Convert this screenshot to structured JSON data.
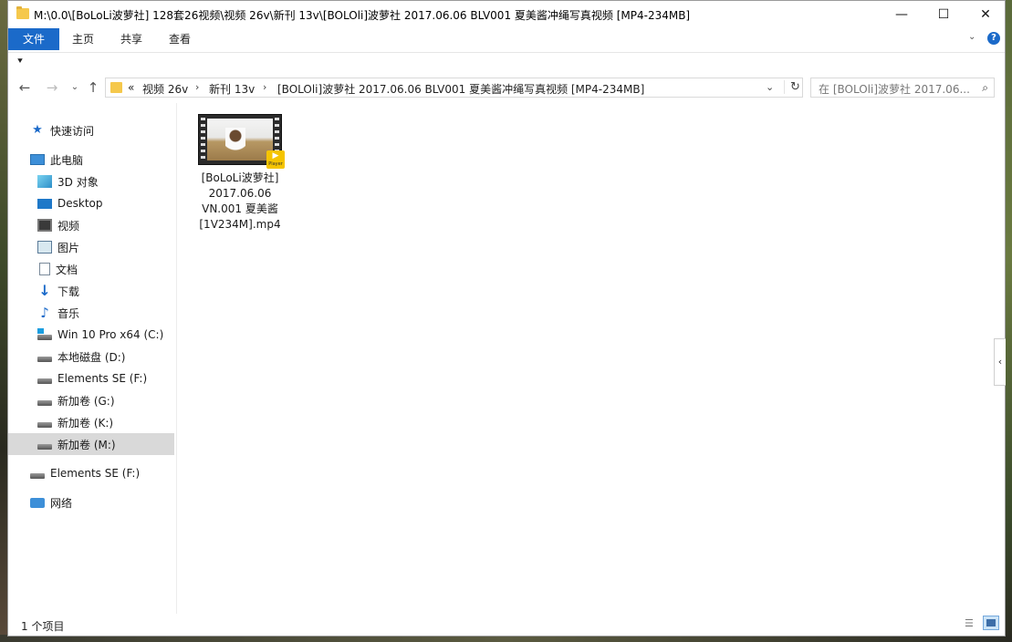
{
  "window": {
    "title": "M:\\0.0\\[BoLoLi波萝社] 128套26视频\\视频 26v\\新刊 13v\\[BOLOli]波萝社 2017.06.06 BLV001 夏美酱冲绳写真视频 [MP4-234MB]",
    "min_glyph": "—",
    "max_glyph": "☐",
    "close_glyph": "✕"
  },
  "ribbon": {
    "file_tab": "文件",
    "tabs": [
      "主页",
      "共享",
      "查看"
    ],
    "chevron": "⌄",
    "help": "?"
  },
  "quick_access": {
    "arrow": "⯆"
  },
  "address": {
    "back": "←",
    "forward": "→",
    "recent": "⌄",
    "up": "↑",
    "overflow": "«",
    "segments": [
      "视频 26v",
      "新刊 13v",
      "[BOLOli]波萝社 2017.06.06 BLV001 夏美酱冲绳写真视频 [MP4-234MB]"
    ],
    "separator": "›",
    "dropdown": "⌄",
    "refresh": "↻"
  },
  "search": {
    "placeholder": "在 [BOLOli]波萝社 2017.06...",
    "icon": "⌕"
  },
  "sidebar": {
    "items": [
      {
        "label": "快速访问",
        "icon": "star-icon"
      },
      {
        "label": "此电脑",
        "icon": "pc-icon"
      },
      {
        "label": "3D 对象",
        "icon": "3d-objects-icon"
      },
      {
        "label": "Desktop",
        "icon": "desktop-icon"
      },
      {
        "label": "视频",
        "icon": "videos-icon"
      },
      {
        "label": "图片",
        "icon": "pictures-icon"
      },
      {
        "label": "文档",
        "icon": "documents-icon"
      },
      {
        "label": "下载",
        "icon": "downloads-icon"
      },
      {
        "label": "音乐",
        "icon": "music-icon"
      },
      {
        "label": "Win 10 Pro x64 (C:)",
        "icon": "system-drive-icon"
      },
      {
        "label": "本地磁盘 (D:)",
        "icon": "drive-icon"
      },
      {
        "label": "Elements SE (F:)",
        "icon": "drive-icon"
      },
      {
        "label": "新加卷 (G:)",
        "icon": "drive-icon"
      },
      {
        "label": "新加卷 (K:)",
        "icon": "drive-icon"
      },
      {
        "label": "新加卷 (M:)",
        "icon": "drive-icon",
        "selected": true
      },
      {
        "label": "Elements SE (F:)",
        "icon": "drive-icon"
      },
      {
        "label": "网络",
        "icon": "network-icon"
      }
    ]
  },
  "file": {
    "name_lines": [
      "[BoLoLi波萝社]",
      "2017.06.06",
      "VN.001 夏美酱",
      "[1V234M].mp4"
    ],
    "badge": "Player"
  },
  "pane_toggle": "‹",
  "status": {
    "count": "1 个项目"
  },
  "colors": {
    "accent": "#1b6ac9",
    "selected_bg": "#d9d9d9",
    "folder": "#f5c84c"
  }
}
